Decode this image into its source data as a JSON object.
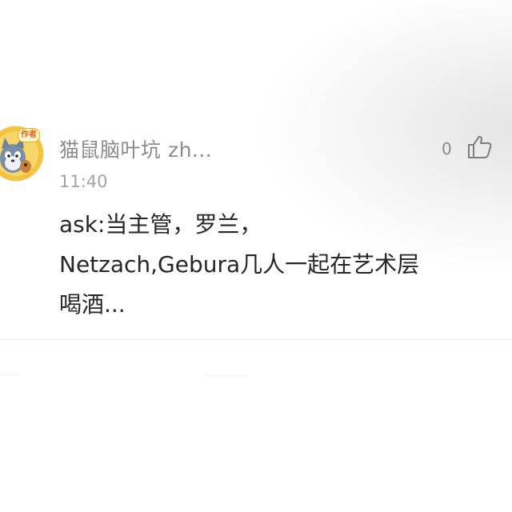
{
  "comment": {
    "author_badge": "作者",
    "username": "猫鼠脑叶坑 zh...",
    "timestamp": "11:40",
    "like_count": "0",
    "content_lines": [
      "ask:当主管，罗兰，",
      "Netzach,Gebura几人一起在艺术层",
      "喝酒..."
    ]
  },
  "colors": {
    "username": "#8a8a8a",
    "timestamp": "#a3a3a3",
    "content": "#262626",
    "badge_text": "#e0661a"
  },
  "icons": {
    "like": "thumbs-up-icon",
    "avatar": "cartoon-cat-avatar"
  }
}
